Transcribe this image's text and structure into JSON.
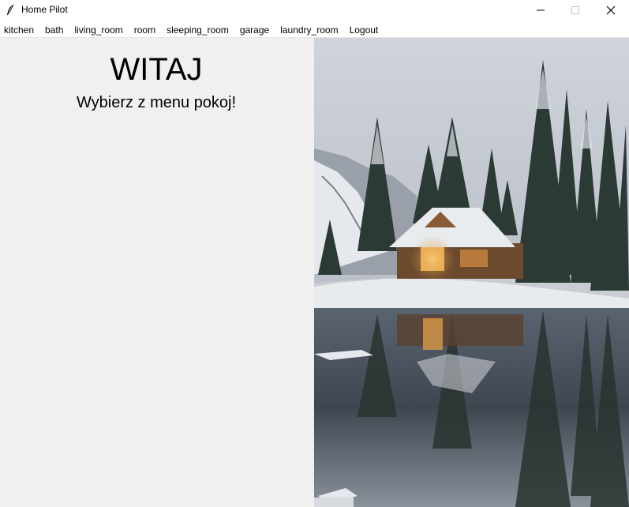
{
  "window": {
    "title": "Home Pilot",
    "icon": "feather-icon",
    "controls": [
      "minimize-icon",
      "maximize-icon",
      "close-icon"
    ]
  },
  "menu": {
    "items": [
      {
        "label": "kitchen"
      },
      {
        "label": "bath"
      },
      {
        "label": "living_room"
      },
      {
        "label": "room"
      },
      {
        "label": "sleeping_room"
      },
      {
        "label": "garage"
      },
      {
        "label": "laundry_room"
      },
      {
        "label": "Logout"
      }
    ]
  },
  "main": {
    "heading": "WITAJ",
    "subheading": "Wybierz z menu pokoj!"
  },
  "image": {
    "subject": "snowy-cabin-lake-photo"
  },
  "colors": {
    "pane_bg": "#f0f0f0",
    "titlebar_bg": "#ffffff"
  }
}
